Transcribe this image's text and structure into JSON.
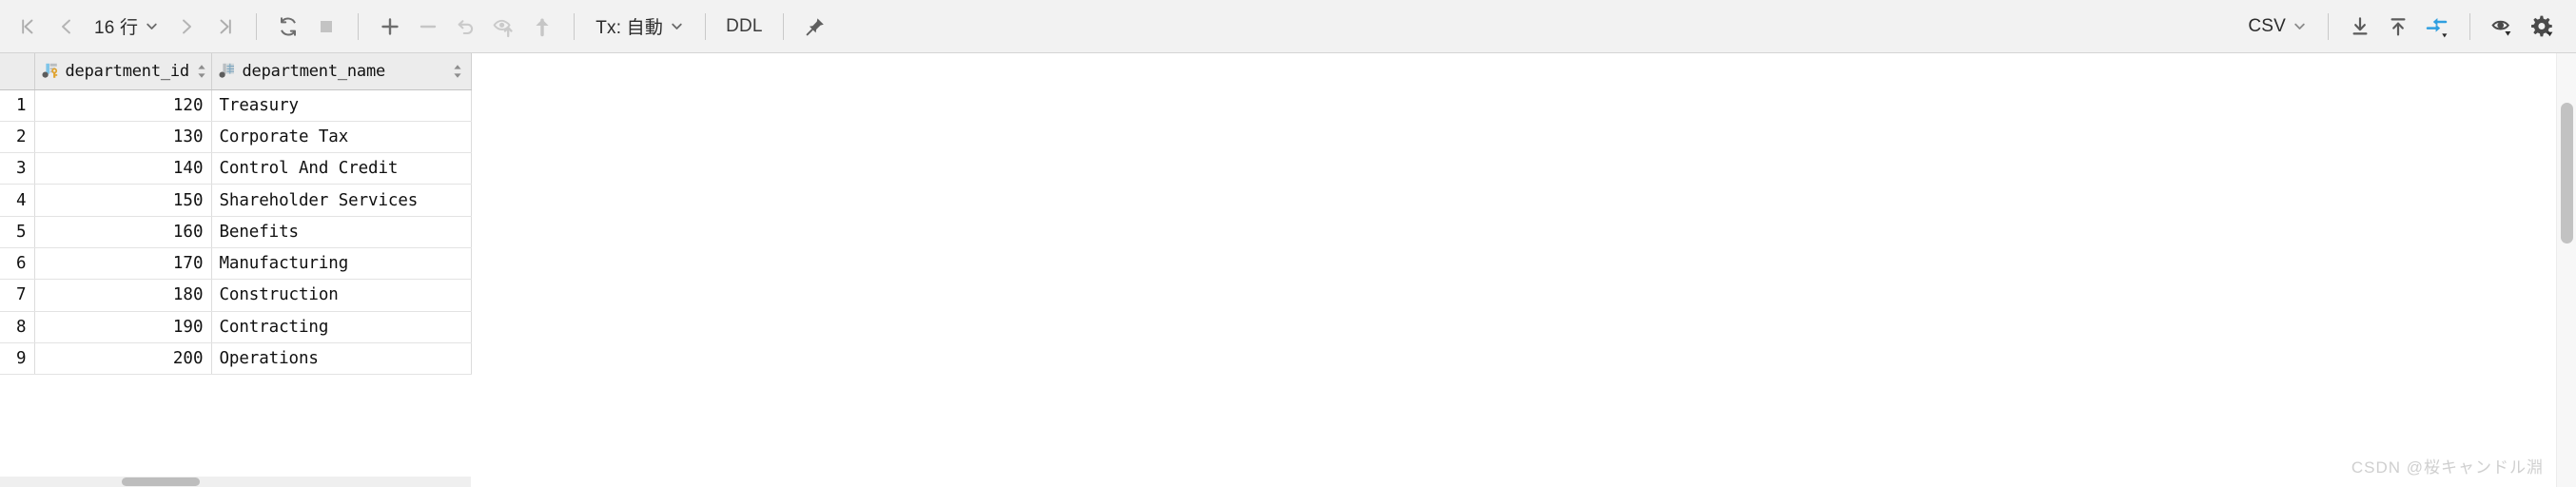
{
  "toolbar": {
    "nav": {
      "first_label": "first-page",
      "prev_label": "previous-page",
      "next_label": "next-page",
      "last_label": "last-page",
      "rows_value": "16 行"
    },
    "reload_label": "reload",
    "stop_label": "stop",
    "add_row_label": "add-row",
    "delete_row_label": "delete-row",
    "revert_label": "revert",
    "load_label": "load-changes",
    "submit_label": "submit",
    "tx_label": "Tx: 自動",
    "ddl_label": "DDL",
    "pin_label": "pin-tab",
    "format_label": "CSV",
    "export_label": "export-to-file",
    "import_label": "import-from-file",
    "compare_label": "compare-data",
    "view_label": "view-options",
    "settings_label": "settings",
    "colors": {
      "accent": "#2f9fe0",
      "icon": "#6e6e6e",
      "icon_dim": "#c0c0c0",
      "bar_bg": "#f2f2f2"
    }
  },
  "grid": {
    "columns": [
      {
        "key": "department_id",
        "label": "department_id",
        "icon": "primary-key-column-icon",
        "align": "right"
      },
      {
        "key": "department_name",
        "label": "department_name",
        "icon": "table-column-icon",
        "align": "left"
      }
    ],
    "rows": [
      {
        "n": "1",
        "department_id": "120",
        "department_name": "Treasury"
      },
      {
        "n": "2",
        "department_id": "130",
        "department_name": "Corporate Tax"
      },
      {
        "n": "3",
        "department_id": "140",
        "department_name": "Control And Credit"
      },
      {
        "n": "4",
        "department_id": "150",
        "department_name": "Shareholder Services"
      },
      {
        "n": "5",
        "department_id": "160",
        "department_name": "Benefits"
      },
      {
        "n": "6",
        "department_id": "170",
        "department_name": "Manufacturing"
      },
      {
        "n": "7",
        "department_id": "180",
        "department_name": "Construction"
      },
      {
        "n": "8",
        "department_id": "190",
        "department_name": "Contracting"
      },
      {
        "n": "9",
        "department_id": "200",
        "department_name": "Operations"
      }
    ]
  },
  "watermark": {
    "text": "CSDN @桜キャンドル淵"
  }
}
